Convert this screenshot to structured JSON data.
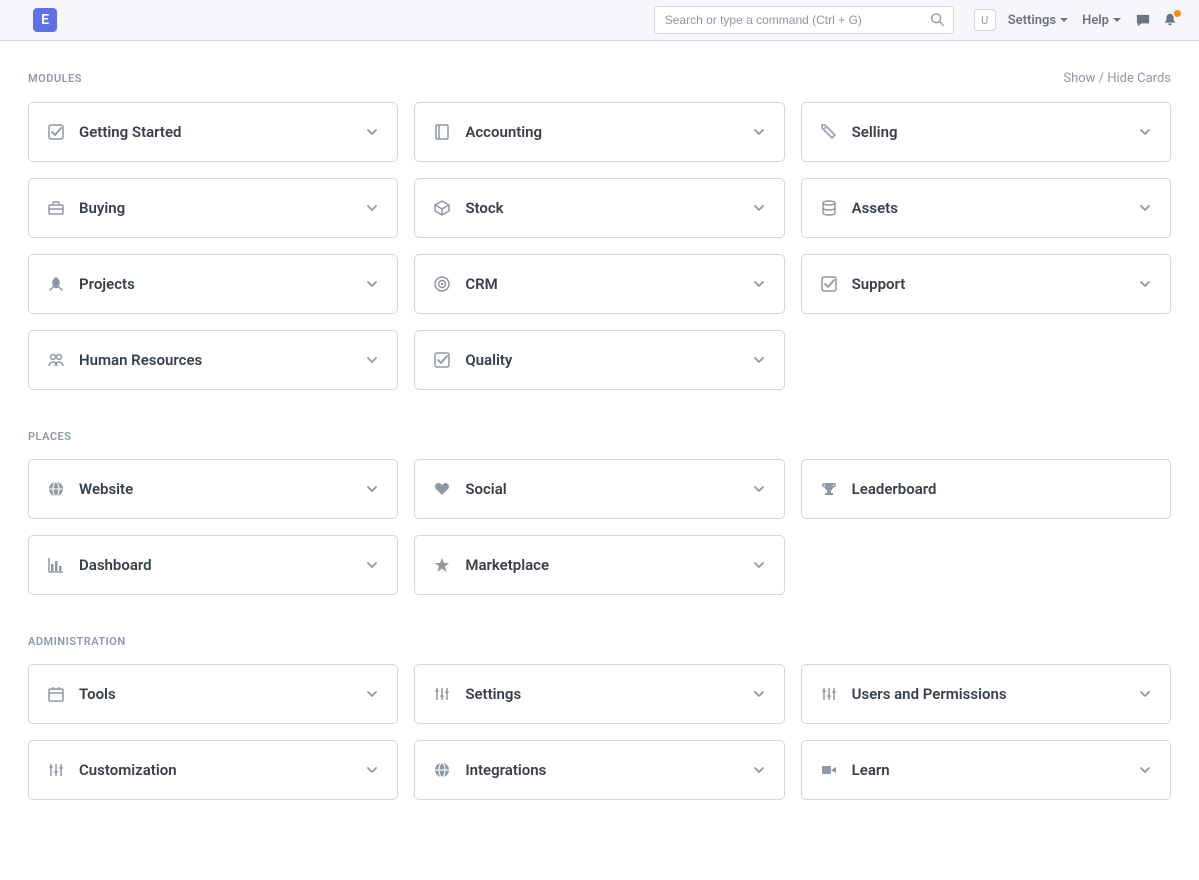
{
  "navbar": {
    "logo_letter": "E",
    "search_placeholder": "Search or type a command (Ctrl + G)",
    "user_initial": "U",
    "settings_label": "Settings",
    "help_label": "Help"
  },
  "show_hide_label": "Show / Hide Cards",
  "sections": [
    {
      "title": "MODULES",
      "show_toggle": true,
      "cards": [
        {
          "label": "Getting Started",
          "icon": "check-square",
          "chevron": true
        },
        {
          "label": "Accounting",
          "icon": "book",
          "chevron": true
        },
        {
          "label": "Selling",
          "icon": "tag",
          "chevron": true
        },
        {
          "label": "Buying",
          "icon": "briefcase",
          "chevron": true
        },
        {
          "label": "Stock",
          "icon": "box",
          "chevron": true
        },
        {
          "label": "Assets",
          "icon": "database",
          "chevron": true
        },
        {
          "label": "Projects",
          "icon": "rocket",
          "chevron": true
        },
        {
          "label": "CRM",
          "icon": "podcast",
          "chevron": true
        },
        {
          "label": "Support",
          "icon": "check-square",
          "chevron": true
        },
        {
          "label": "Human Resources",
          "icon": "users",
          "chevron": true
        },
        {
          "label": "Quality",
          "icon": "check-square",
          "chevron": true
        }
      ]
    },
    {
      "title": "PLACES",
      "show_toggle": false,
      "cards": [
        {
          "label": "Website",
          "icon": "globe",
          "chevron": true
        },
        {
          "label": "Social",
          "icon": "heart",
          "chevron": true
        },
        {
          "label": "Leaderboard",
          "icon": "trophy",
          "chevron": false
        },
        {
          "label": "Dashboard",
          "icon": "bar-chart",
          "chevron": true
        },
        {
          "label": "Marketplace",
          "icon": "star",
          "chevron": true
        }
      ]
    },
    {
      "title": "ADMINISTRATION",
      "show_toggle": false,
      "cards": [
        {
          "label": "Tools",
          "icon": "calendar",
          "chevron": true
        },
        {
          "label": "Settings",
          "icon": "sliders",
          "chevron": true
        },
        {
          "label": "Users and Permissions",
          "icon": "sliders",
          "chevron": true
        },
        {
          "label": "Customization",
          "icon": "sliders",
          "chevron": true
        },
        {
          "label": "Integrations",
          "icon": "globe",
          "chevron": true
        },
        {
          "label": "Learn",
          "icon": "video",
          "chevron": true
        }
      ]
    }
  ]
}
